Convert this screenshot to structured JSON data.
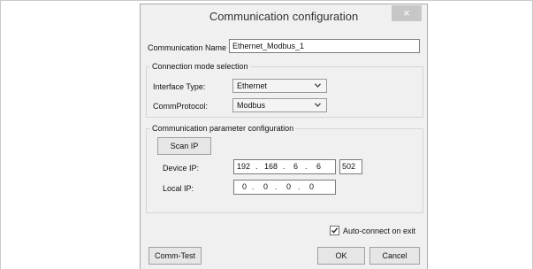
{
  "dialog": {
    "title": "Communication configuration",
    "close_glyph": "×"
  },
  "comm_name": {
    "label": "Communication Name :",
    "value": "Ethernet_Modbus_1"
  },
  "connection_mode": {
    "title": "Connection mode selection",
    "interface_type_label": "Interface Type:",
    "interface_type_value": "Ethernet",
    "comm_protocol_label": "CommProtocol:",
    "comm_protocol_value": "Modbus"
  },
  "comm_params": {
    "title": "Communication parameter configuration",
    "scan_ip_label": "Scan IP",
    "device_ip_label": "Device IP:",
    "device_ip": [
      "192",
      "168",
      "6",
      "6"
    ],
    "port": "502",
    "local_ip_label": "Local IP:",
    "local_ip": [
      "0",
      "0",
      "0",
      "0"
    ]
  },
  "auto_connect": {
    "label": "Auto-connect on exit",
    "checked": true
  },
  "buttons": {
    "comm_test": "Comm-Test",
    "ok": "OK",
    "cancel": "Cancel"
  },
  "icons": {
    "close": "close-icon",
    "dropdown": "chevron-down-icon",
    "check": "checkmark-icon"
  }
}
